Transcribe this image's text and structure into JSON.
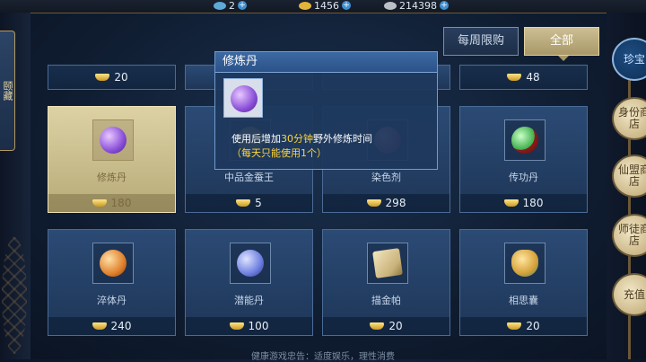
{
  "topbar": {
    "currencies": [
      {
        "icon": "blue-gem-icon",
        "value": "2"
      },
      {
        "icon": "gold-ingot-icon",
        "value": "1456"
      },
      {
        "icon": "silver-coin-icon",
        "value": "214398"
      }
    ]
  },
  "left_tab": {
    "label": "颐藏"
  },
  "filters": {
    "weekly": "每周限购",
    "all": "全部",
    "selected": "全部"
  },
  "right_tabs": [
    {
      "label": "珍宝",
      "active": true
    },
    {
      "label": "身份商店",
      "active": false
    },
    {
      "label": "仙盟商店",
      "active": false
    },
    {
      "label": "师徒商店",
      "active": false
    },
    {
      "label": "充值",
      "active": false
    }
  ],
  "top_row_prices": [
    "20",
    "",
    "",
    "48"
  ],
  "items": [
    {
      "name": "修炼丹",
      "price": "180",
      "icon": "purple-pill-icon",
      "color": "#8a4fd8",
      "selected": true
    },
    {
      "name": "中品金蚕王",
      "price": "5",
      "icon": "gold-silkworm-icon",
      "color": "#d4a83a",
      "selected": false
    },
    {
      "name": "染色剂",
      "price": "298",
      "icon": "dye-icon",
      "color": "#c04a7a",
      "selected": false
    },
    {
      "name": "传功丹",
      "price": "180",
      "icon": "green-orb-icon",
      "color": "#3fae4a",
      "selected": false
    },
    {
      "name": "淬体丹",
      "price": "240",
      "icon": "orange-pill-icon",
      "color": "#e0812c",
      "selected": false
    },
    {
      "name": "潜能丹",
      "price": "100",
      "icon": "blue-pill-icon",
      "color": "#6c7fe0",
      "selected": false
    },
    {
      "name": "描金帕",
      "price": "20",
      "icon": "gold-handkerchief-icon",
      "color": "#d8c48a",
      "selected": false
    },
    {
      "name": "相思囊",
      "price": "20",
      "icon": "sachet-icon",
      "color": "#d6a13a",
      "selected": false
    }
  ],
  "tooltip": {
    "title": "修炼丹",
    "desc_prefix": "使用后增加",
    "desc_highlight": "30分钟",
    "desc_suffix": "野外修炼时间",
    "limit": "（每天只能使用1个）",
    "icon": "purple-pill-icon"
  },
  "footer": "健康游戏忠告：适度娱乐，理性消费"
}
